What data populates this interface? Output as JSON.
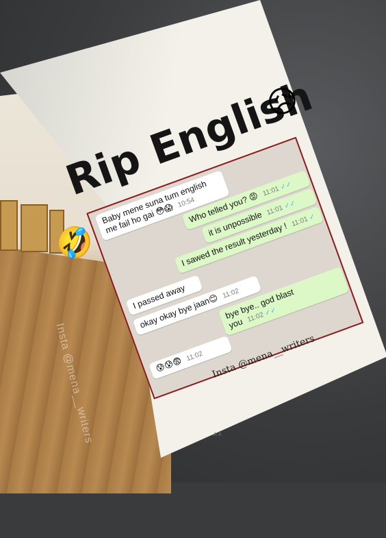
{
  "title": "Rip English",
  "title_emoji": "😥",
  "side_emoji": "🤣",
  "messages": [
    {
      "dir": "in",
      "text": "Baby mene suna tum english me fail ho gai 😳😱",
      "time": "10:54",
      "ticks": ""
    },
    {
      "dir": "out",
      "text": "Who telled you? 😡",
      "time": "11:01",
      "ticks": "✓✓"
    },
    {
      "dir": "out",
      "text": "it is unpossible",
      "time": "11:01",
      "ticks": "✓✓"
    },
    {
      "dir": "out",
      "text": "I sawed the result yesterday !",
      "time": "11:01",
      "ticks": "✓"
    },
    {
      "dir": "in",
      "text": "I passed away",
      "time": "",
      "ticks": ""
    },
    {
      "dir": "in",
      "text": "okay okay bye jaan😊",
      "time": "11:02",
      "ticks": ""
    },
    {
      "dir": "out",
      "text": "bye bye.. god blast you",
      "time": "11:02",
      "ticks": "✓✓"
    },
    {
      "dir": "in",
      "text": "😰😰😨",
      "time": "11:02",
      "ticks": ""
    }
  ],
  "watermark": "Insta @mena__writers",
  "vertical_watermark": "Insta @mena__writers",
  "page_mark": "ʌ ʌ"
}
